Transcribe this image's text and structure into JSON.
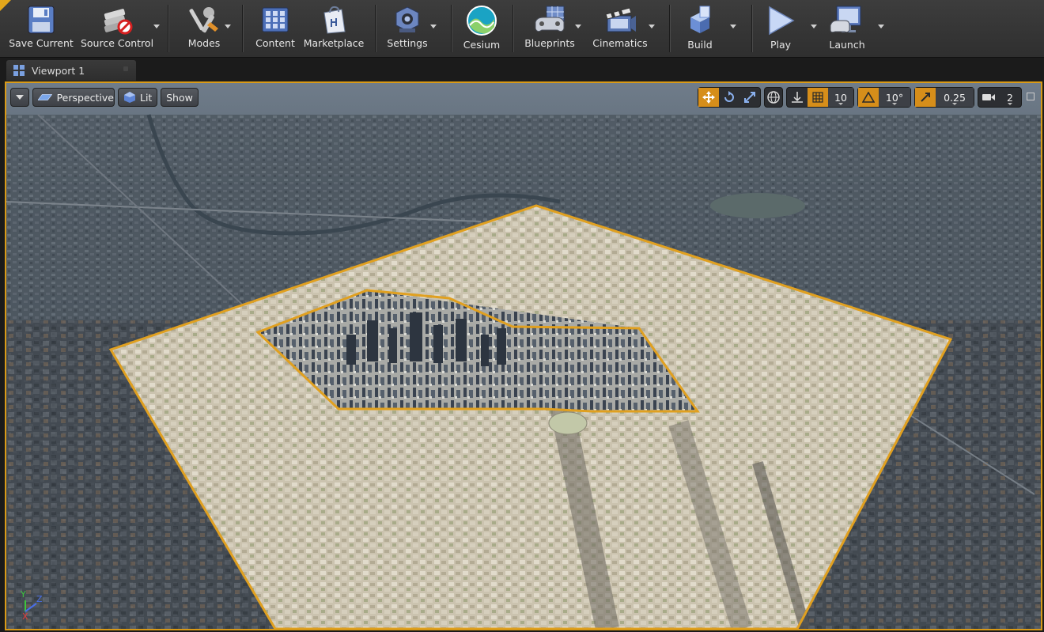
{
  "toolbar": {
    "save_current": "Save Current",
    "source_control": "Source Control",
    "modes": "Modes",
    "content": "Content",
    "marketplace": "Marketplace",
    "settings": "Settings",
    "cesium": "Cesium",
    "blueprints": "Blueprints",
    "cinematics": "Cinematics",
    "build": "Build",
    "play": "Play",
    "launch": "Launch"
  },
  "tab": {
    "label": "Viewport 1"
  },
  "viewport": {
    "perspective_label": "Perspective",
    "lit_label": "Lit",
    "show_label": "Show",
    "grid_snap_value": "10",
    "rotation_snap_value": "10°",
    "scale_snap_value": "0.25",
    "camera_speed_value": "2",
    "axis": {
      "x": "X",
      "y": "Y",
      "z": "Z"
    }
  },
  "colors": {
    "accent": "#d99a17",
    "selection_outline": "#e0a020",
    "toolbar_bg": "#353535",
    "text": "#e4e4e4"
  },
  "icons": {
    "save": "floppy-disk-icon",
    "source_control": "source-control-disabled-icon",
    "modes": "wrench-tools-icon",
    "content": "content-grid-icon",
    "marketplace": "marketplace-bag-icon",
    "settings": "gear-cubes-icon",
    "cesium": "cesium-globe-icon",
    "blueprints": "gamepad-blueprint-icon",
    "cinematics": "clapperboard-icon",
    "build": "build-blocks-icon",
    "play": "play-triangle-icon",
    "launch": "launch-monitor-icon"
  }
}
